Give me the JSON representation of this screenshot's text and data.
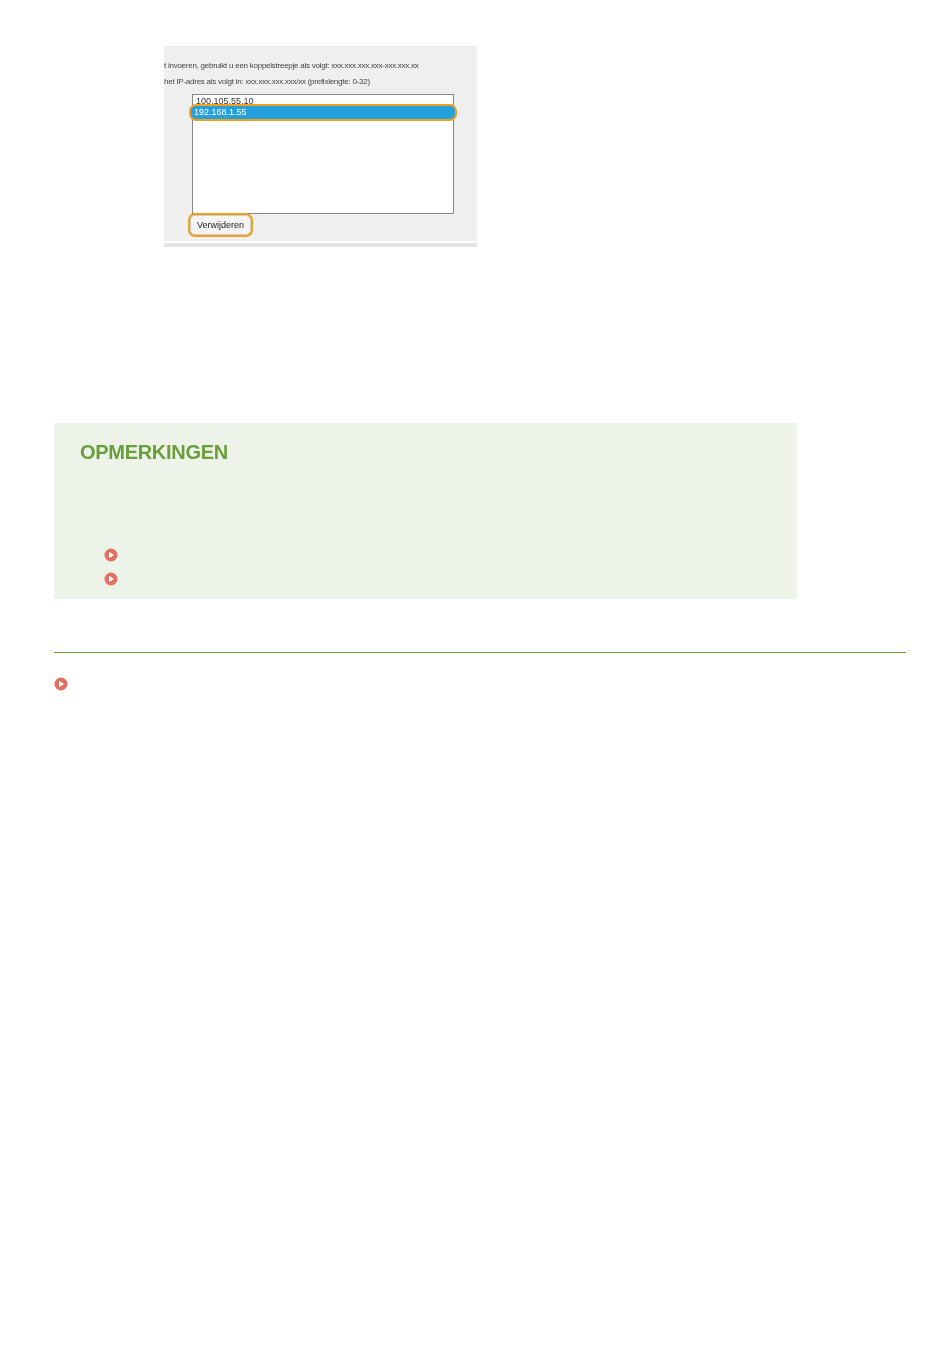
{
  "screenshot": {
    "instructions": [
      "t invoeren, gebruikt u een koppelstreepje als volgt: xxx.xxx.xxx.xxx-xxx.xxx.xx",
      "het IP-adres als volgt in: xxx.xxx.xxx.xxx/xx (prefixlengte: 0-32)"
    ],
    "address_list": [
      {
        "text": "100.105.55.10",
        "selected": false,
        "highlighted": false
      },
      {
        "text": "192.168.1.55",
        "selected": true,
        "highlighted": true
      }
    ],
    "button": {
      "label": "Verwijderen",
      "highlighted": true
    }
  },
  "notes": {
    "heading": "OPMERKINGEN",
    "bullets": [
      {
        "kind": "arrow"
      },
      {
        "kind": "arrow"
      }
    ]
  },
  "footer_bullets": [
    {
      "kind": "arrow"
    }
  ]
}
